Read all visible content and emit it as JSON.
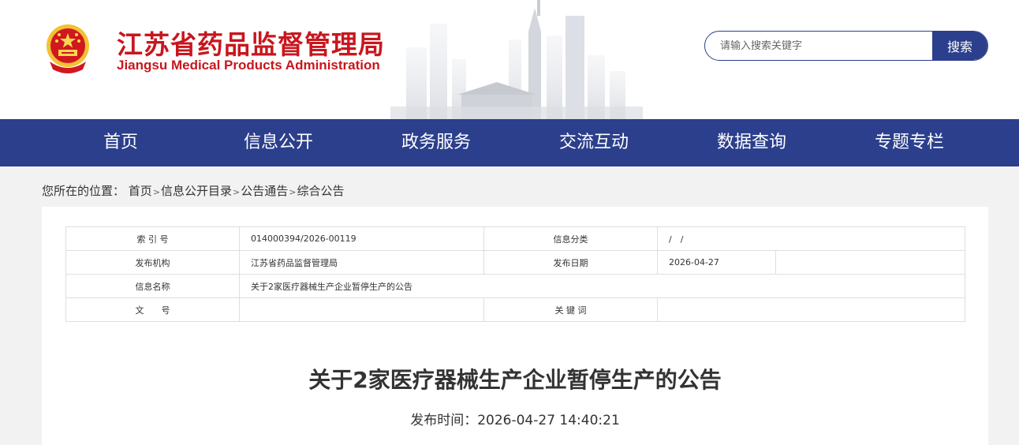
{
  "header": {
    "title_cn": "江苏省药品监督管理局",
    "title_en": "Jiangsu Medical Products Administration",
    "logo_icon": "national-emblem-icon"
  },
  "search": {
    "placeholder": "请输入搜索关键字",
    "button_label": "搜索"
  },
  "nav": {
    "items": [
      "首页",
      "信息公开",
      "政务服务",
      "交流互动",
      "数据查询",
      "专题专栏"
    ]
  },
  "breadcrumb": {
    "prefix": "您所在的位置：",
    "items": [
      "首页",
      "信息公开目录",
      "公告通告",
      "综合公告"
    ],
    "separator": ">"
  },
  "meta": {
    "index_label": "索 引 号",
    "index_value": "014000394/2026-00119",
    "category_label": "信息分类",
    "category_value": "/　/",
    "publisher_label": "发布机构",
    "publisher_value": "江苏省药品监督管理局",
    "date_label": "发布日期",
    "date_value": "2026-04-27",
    "name_label": "信息名称",
    "name_value": "关于2家医疗器械生产企业暂停生产的公告",
    "docno_label": "文　　号",
    "docno_value": "",
    "keywords_label": "关 键 词",
    "keywords_value": ""
  },
  "article": {
    "title": "关于2家医疗器械生产企业暂停生产的公告",
    "time_label": "发布时间：",
    "time_value": "2026-04-27 14:40:21"
  },
  "colors": {
    "brand_red": "#c8161d",
    "nav_blue": "#2b3f8c",
    "page_bg": "#f2f2f2"
  }
}
